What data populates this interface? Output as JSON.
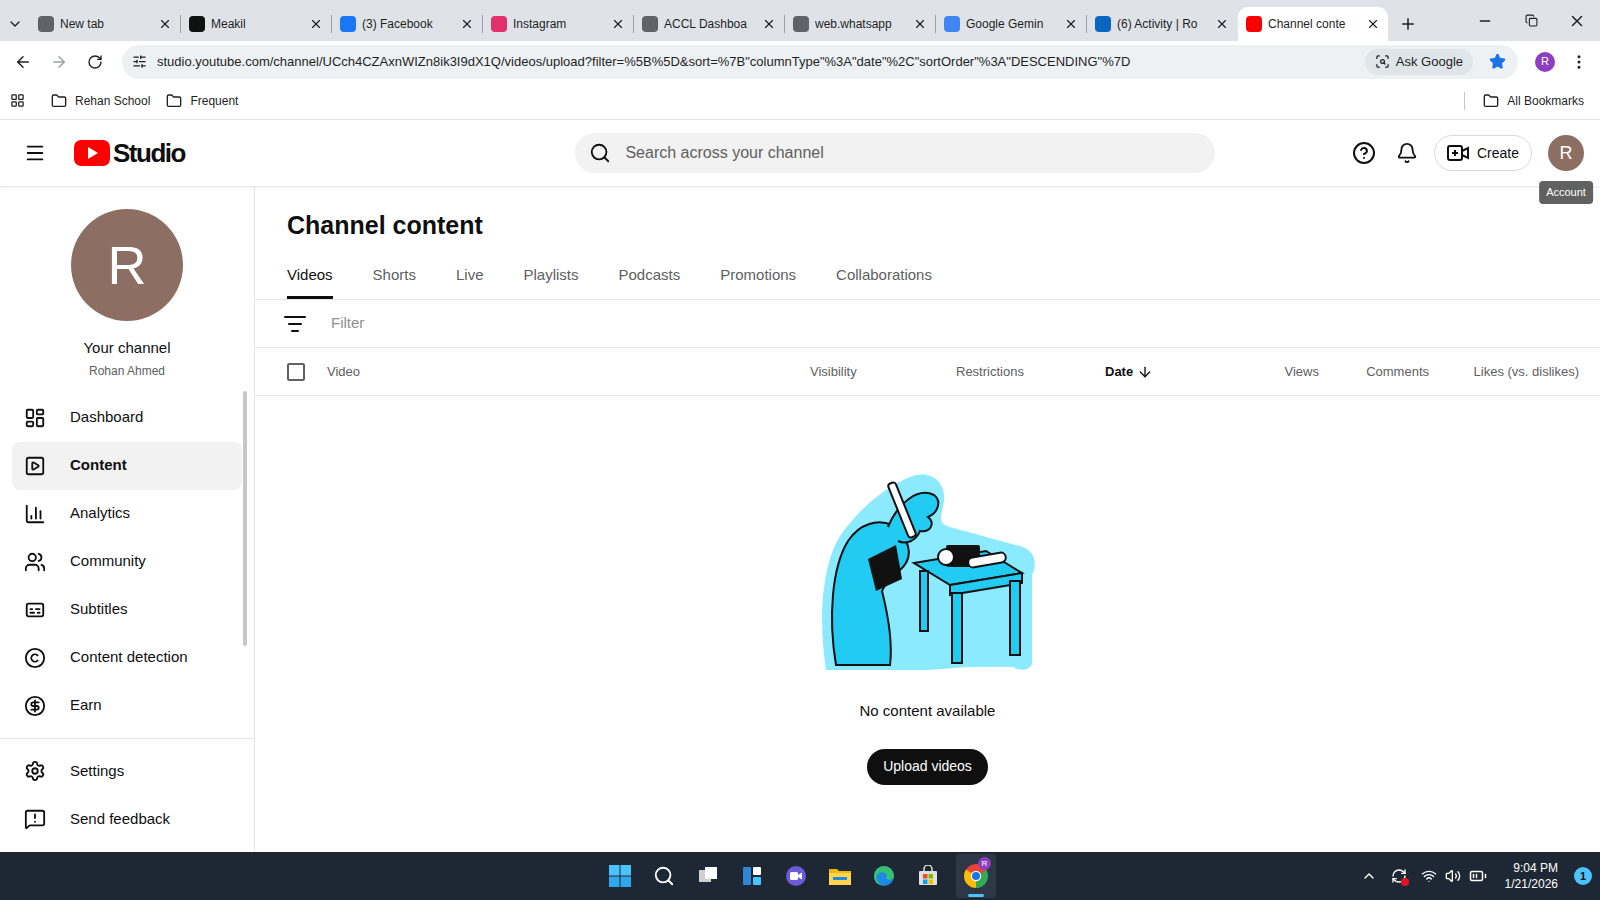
{
  "browser": {
    "tabs": [
      {
        "label": "New tab",
        "selected": false,
        "color": "#5f6368"
      },
      {
        "label": "Meakil",
        "selected": false,
        "color": "#111111"
      },
      {
        "label": "(3) Facebook",
        "selected": false,
        "color": "#1877f2"
      },
      {
        "label": "Instagram",
        "selected": false,
        "color": "#e1306c"
      },
      {
        "label": "ACCL Dashboa",
        "selected": false,
        "color": "#5f6368"
      },
      {
        "label": "web.whatsapp",
        "selected": false,
        "color": "#5f6368"
      },
      {
        "label": "Google Gemin",
        "selected": false,
        "color": "#4285f4"
      },
      {
        "label": "(6) Activity | Ro",
        "selected": false,
        "color": "#0a66c2"
      },
      {
        "label": "Channel conte",
        "selected": true,
        "color": "#ff0000"
      }
    ],
    "address": "studio.youtube.com/channel/UCch4CZAxnWIZn8ik3I9dX1Q/videos/upload?filter=%5B%5D&sort=%7B\"columnType\"%3A\"date\"%2C\"sortOrder\"%3A\"DESCENDING\"%7D",
    "ask_google": "Ask Google",
    "bookmarked": true,
    "profile": "R",
    "bookmarks": [
      "Rehan School",
      "Frequent"
    ],
    "all_bookmarks": "All Bookmarks"
  },
  "studio": {
    "logo": "Studio",
    "search_placeholder": "Search across your channel",
    "create": "Create",
    "avatar": "R",
    "tooltip": "Account",
    "channel": {
      "avatar": "R",
      "title": "Your channel",
      "name": "Rohan Ahmed"
    },
    "sidebar": {
      "items": [
        {
          "label": "Dashboard",
          "selected": false
        },
        {
          "label": "Content",
          "selected": true
        },
        {
          "label": "Analytics",
          "selected": false
        },
        {
          "label": "Community",
          "selected": false
        },
        {
          "label": "Subtitles",
          "selected": false
        },
        {
          "label": "Content detection",
          "selected": false
        },
        {
          "label": "Earn",
          "selected": false
        }
      ],
      "footer_items": [
        {
          "label": "Settings",
          "selected": false
        },
        {
          "label": "Send feedback",
          "selected": false
        }
      ]
    },
    "heading": "Channel content",
    "tabs": [
      {
        "label": "Videos",
        "selected": true
      },
      {
        "label": "Shorts",
        "selected": false
      },
      {
        "label": "Live",
        "selected": false
      },
      {
        "label": "Playlists",
        "selected": false
      },
      {
        "label": "Podcasts",
        "selected": false
      },
      {
        "label": "Promotions",
        "selected": false
      },
      {
        "label": "Collaborations",
        "selected": false
      }
    ],
    "filter_placeholder": "Filter",
    "select_all_checked": false,
    "columns": [
      {
        "label": "Video",
        "sorted": false
      },
      {
        "label": "Visibility",
        "sorted": false
      },
      {
        "label": "Restrictions",
        "sorted": false
      },
      {
        "label": "Date",
        "sorted": true
      },
      {
        "label": "Views",
        "sorted": false
      },
      {
        "label": "Comments",
        "sorted": false
      },
      {
        "label": "Likes (vs. dislikes)",
        "sorted": false
      }
    ],
    "empty": {
      "message": "No content available",
      "button": "Upload videos"
    }
  },
  "taskbar": {
    "time": "9:04 PM",
    "date": "1/21/2026",
    "notifications": "1",
    "chrome_badge": "R"
  }
}
